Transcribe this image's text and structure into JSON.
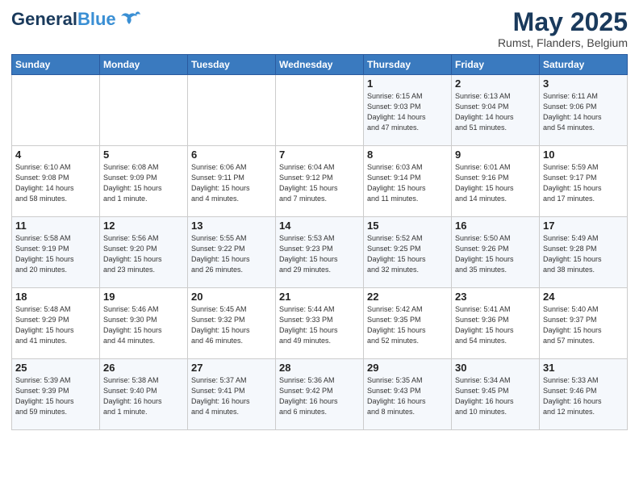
{
  "header": {
    "logo_general": "General",
    "logo_blue": "Blue",
    "month_title": "May 2025",
    "location": "Rumst, Flanders, Belgium"
  },
  "days_of_week": [
    "Sunday",
    "Monday",
    "Tuesday",
    "Wednesday",
    "Thursday",
    "Friday",
    "Saturday"
  ],
  "weeks": [
    [
      {
        "day": "",
        "info": ""
      },
      {
        "day": "",
        "info": ""
      },
      {
        "day": "",
        "info": ""
      },
      {
        "day": "",
        "info": ""
      },
      {
        "day": "1",
        "info": "Sunrise: 6:15 AM\nSunset: 9:03 PM\nDaylight: 14 hours\nand 47 minutes."
      },
      {
        "day": "2",
        "info": "Sunrise: 6:13 AM\nSunset: 9:04 PM\nDaylight: 14 hours\nand 51 minutes."
      },
      {
        "day": "3",
        "info": "Sunrise: 6:11 AM\nSunset: 9:06 PM\nDaylight: 14 hours\nand 54 minutes."
      }
    ],
    [
      {
        "day": "4",
        "info": "Sunrise: 6:10 AM\nSunset: 9:08 PM\nDaylight: 14 hours\nand 58 minutes."
      },
      {
        "day": "5",
        "info": "Sunrise: 6:08 AM\nSunset: 9:09 PM\nDaylight: 15 hours\nand 1 minute."
      },
      {
        "day": "6",
        "info": "Sunrise: 6:06 AM\nSunset: 9:11 PM\nDaylight: 15 hours\nand 4 minutes."
      },
      {
        "day": "7",
        "info": "Sunrise: 6:04 AM\nSunset: 9:12 PM\nDaylight: 15 hours\nand 7 minutes."
      },
      {
        "day": "8",
        "info": "Sunrise: 6:03 AM\nSunset: 9:14 PM\nDaylight: 15 hours\nand 11 minutes."
      },
      {
        "day": "9",
        "info": "Sunrise: 6:01 AM\nSunset: 9:16 PM\nDaylight: 15 hours\nand 14 minutes."
      },
      {
        "day": "10",
        "info": "Sunrise: 5:59 AM\nSunset: 9:17 PM\nDaylight: 15 hours\nand 17 minutes."
      }
    ],
    [
      {
        "day": "11",
        "info": "Sunrise: 5:58 AM\nSunset: 9:19 PM\nDaylight: 15 hours\nand 20 minutes."
      },
      {
        "day": "12",
        "info": "Sunrise: 5:56 AM\nSunset: 9:20 PM\nDaylight: 15 hours\nand 23 minutes."
      },
      {
        "day": "13",
        "info": "Sunrise: 5:55 AM\nSunset: 9:22 PM\nDaylight: 15 hours\nand 26 minutes."
      },
      {
        "day": "14",
        "info": "Sunrise: 5:53 AM\nSunset: 9:23 PM\nDaylight: 15 hours\nand 29 minutes."
      },
      {
        "day": "15",
        "info": "Sunrise: 5:52 AM\nSunset: 9:25 PM\nDaylight: 15 hours\nand 32 minutes."
      },
      {
        "day": "16",
        "info": "Sunrise: 5:50 AM\nSunset: 9:26 PM\nDaylight: 15 hours\nand 35 minutes."
      },
      {
        "day": "17",
        "info": "Sunrise: 5:49 AM\nSunset: 9:28 PM\nDaylight: 15 hours\nand 38 minutes."
      }
    ],
    [
      {
        "day": "18",
        "info": "Sunrise: 5:48 AM\nSunset: 9:29 PM\nDaylight: 15 hours\nand 41 minutes."
      },
      {
        "day": "19",
        "info": "Sunrise: 5:46 AM\nSunset: 9:30 PM\nDaylight: 15 hours\nand 44 minutes."
      },
      {
        "day": "20",
        "info": "Sunrise: 5:45 AM\nSunset: 9:32 PM\nDaylight: 15 hours\nand 46 minutes."
      },
      {
        "day": "21",
        "info": "Sunrise: 5:44 AM\nSunset: 9:33 PM\nDaylight: 15 hours\nand 49 minutes."
      },
      {
        "day": "22",
        "info": "Sunrise: 5:42 AM\nSunset: 9:35 PM\nDaylight: 15 hours\nand 52 minutes."
      },
      {
        "day": "23",
        "info": "Sunrise: 5:41 AM\nSunset: 9:36 PM\nDaylight: 15 hours\nand 54 minutes."
      },
      {
        "day": "24",
        "info": "Sunrise: 5:40 AM\nSunset: 9:37 PM\nDaylight: 15 hours\nand 57 minutes."
      }
    ],
    [
      {
        "day": "25",
        "info": "Sunrise: 5:39 AM\nSunset: 9:39 PM\nDaylight: 15 hours\nand 59 minutes."
      },
      {
        "day": "26",
        "info": "Sunrise: 5:38 AM\nSunset: 9:40 PM\nDaylight: 16 hours\nand 1 minute."
      },
      {
        "day": "27",
        "info": "Sunrise: 5:37 AM\nSunset: 9:41 PM\nDaylight: 16 hours\nand 4 minutes."
      },
      {
        "day": "28",
        "info": "Sunrise: 5:36 AM\nSunset: 9:42 PM\nDaylight: 16 hours\nand 6 minutes."
      },
      {
        "day": "29",
        "info": "Sunrise: 5:35 AM\nSunset: 9:43 PM\nDaylight: 16 hours\nand 8 minutes."
      },
      {
        "day": "30",
        "info": "Sunrise: 5:34 AM\nSunset: 9:45 PM\nDaylight: 16 hours\nand 10 minutes."
      },
      {
        "day": "31",
        "info": "Sunrise: 5:33 AM\nSunset: 9:46 PM\nDaylight: 16 hours\nand 12 minutes."
      }
    ]
  ]
}
